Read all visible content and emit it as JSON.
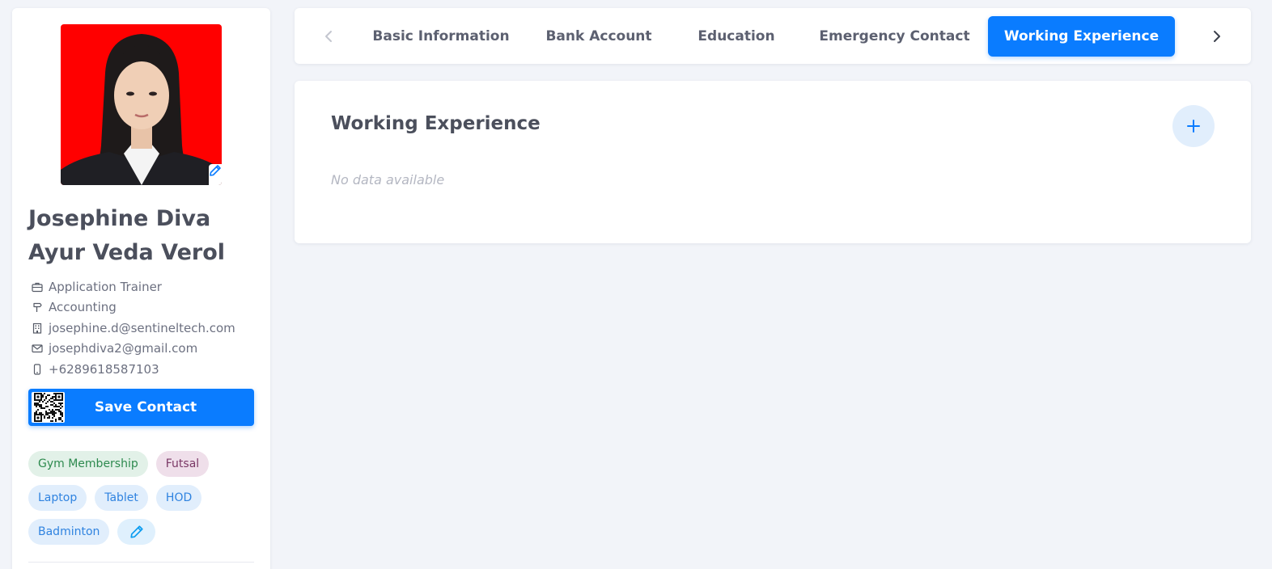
{
  "profile": {
    "name": "Josephine Diva Ayur Veda Verol",
    "job_title": "Application Trainer",
    "department": "Accounting",
    "work_email": "josephine.d@sentineltech.com",
    "personal_email": "josephdiva2@gmail.com",
    "phone": "+6289618587103",
    "save_contact_label": "Save Contact",
    "tags": [
      "Gym Membership",
      "Futsal",
      "Laptop",
      "Tablet",
      "HOD",
      "Badminton"
    ]
  },
  "tabs": {
    "basic_information": "Basic Information",
    "bank_account": "Bank Account",
    "education": "Education",
    "emergency_contact": "Emergency Contact",
    "working_experience": "Working Experience",
    "active": "Working Experience"
  },
  "content": {
    "section_title": "Working Experience",
    "empty_text": "No data available"
  },
  "colors": {
    "accent": "#0a7cff",
    "background": "#f2f4f9",
    "photo_background": "#ff0000",
    "tag_green_bg": "#e2f1e8",
    "tag_purple_bg": "#efdfea",
    "tag_blue_bg": "#e1eefc"
  },
  "icons": {
    "photo_edit": "pencil-icon",
    "job_title": "briefcase-icon",
    "department": "signpost-icon",
    "work_email": "building-icon",
    "personal_email": "envelope-icon",
    "phone": "phone-icon",
    "save_contact": "qr-code-icon",
    "tags_edit": "pencil-icon",
    "tab_prev": "chevron-left-icon",
    "tab_next": "chevron-right-icon",
    "add": "plus-icon"
  }
}
